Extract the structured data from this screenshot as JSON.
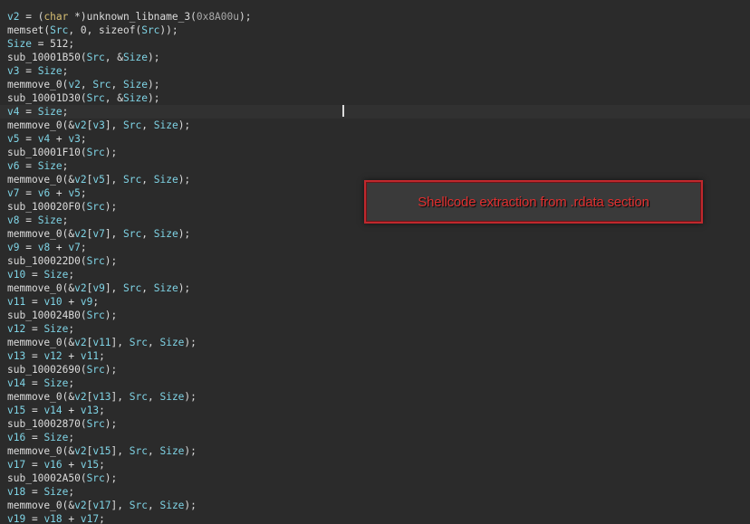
{
  "colors": {
    "background": "#2b2b2b",
    "identifier": "#7fd4e6",
    "keyword": "#d7bf73",
    "plain": "#dcdcdc",
    "number": "#a9a9a9",
    "annotation": "#e03030"
  },
  "code_lines": [
    [
      [
        "v2",
        "id"
      ],
      [
        " = (",
        "p"
      ],
      [
        "char",
        "kw"
      ],
      [
        " *)unknown_libname_3(",
        "p"
      ],
      [
        "0x8A00u",
        "num"
      ],
      [
        ");",
        "p"
      ]
    ],
    [
      [
        "memset(",
        "p"
      ],
      [
        "Src",
        "id"
      ],
      [
        ", 0, sizeof(",
        "p"
      ],
      [
        "Src",
        "id"
      ],
      [
        "));",
        "p"
      ]
    ],
    [
      [
        "Size",
        "id"
      ],
      [
        " = 512;",
        "p"
      ]
    ],
    [
      [
        "sub_10001B50(",
        "p"
      ],
      [
        "Src",
        "id"
      ],
      [
        ", &",
        "p"
      ],
      [
        "Size",
        "id"
      ],
      [
        ");",
        "p"
      ]
    ],
    [
      [
        "v3",
        "id"
      ],
      [
        " = ",
        "p"
      ],
      [
        "Size",
        "id"
      ],
      [
        ";",
        "p"
      ]
    ],
    [
      [
        "memmove_0(",
        "p"
      ],
      [
        "v2",
        "id"
      ],
      [
        ", ",
        "p"
      ],
      [
        "Src",
        "id"
      ],
      [
        ", ",
        "p"
      ],
      [
        "Size",
        "id"
      ],
      [
        ");",
        "p"
      ]
    ],
    [
      [
        "sub_10001D30(",
        "p"
      ],
      [
        "Src",
        "id"
      ],
      [
        ", &",
        "p"
      ],
      [
        "Size",
        "id"
      ],
      [
        ");",
        "p"
      ]
    ],
    [
      [
        "v4",
        "id"
      ],
      [
        " = ",
        "p"
      ],
      [
        "Size",
        "id"
      ],
      [
        ";",
        "p"
      ]
    ],
    [
      [
        "memmove_0(&",
        "p"
      ],
      [
        "v2",
        "id"
      ],
      [
        "[",
        "p"
      ],
      [
        "v3",
        "id"
      ],
      [
        "], ",
        "p"
      ],
      [
        "Src",
        "id"
      ],
      [
        ", ",
        "p"
      ],
      [
        "Size",
        "id"
      ],
      [
        ");",
        "p"
      ]
    ],
    [
      [
        "v5",
        "id"
      ],
      [
        " = ",
        "p"
      ],
      [
        "v4",
        "id"
      ],
      [
        " + ",
        "p"
      ],
      [
        "v3",
        "id"
      ],
      [
        ";",
        "p"
      ]
    ],
    [
      [
        "sub_10001F10(",
        "p"
      ],
      [
        "Src",
        "id"
      ],
      [
        ");",
        "p"
      ]
    ],
    [
      [
        "v6",
        "id"
      ],
      [
        " = ",
        "p"
      ],
      [
        "Size",
        "id"
      ],
      [
        ";",
        "p"
      ]
    ],
    [
      [
        "memmove_0(&",
        "p"
      ],
      [
        "v2",
        "id"
      ],
      [
        "[",
        "p"
      ],
      [
        "v5",
        "id"
      ],
      [
        "], ",
        "p"
      ],
      [
        "Src",
        "id"
      ],
      [
        ", ",
        "p"
      ],
      [
        "Size",
        "id"
      ],
      [
        ");",
        "p"
      ]
    ],
    [
      [
        "v7",
        "id"
      ],
      [
        " = ",
        "p"
      ],
      [
        "v6",
        "id"
      ],
      [
        " + ",
        "p"
      ],
      [
        "v5",
        "id"
      ],
      [
        ";",
        "p"
      ]
    ],
    [
      [
        "sub_100020F0(",
        "p"
      ],
      [
        "Src",
        "id"
      ],
      [
        ");",
        "p"
      ]
    ],
    [
      [
        "v8",
        "id"
      ],
      [
        " = ",
        "p"
      ],
      [
        "Size",
        "id"
      ],
      [
        ";",
        "p"
      ]
    ],
    [
      [
        "memmove_0(&",
        "p"
      ],
      [
        "v2",
        "id"
      ],
      [
        "[",
        "p"
      ],
      [
        "v7",
        "id"
      ],
      [
        "], ",
        "p"
      ],
      [
        "Src",
        "id"
      ],
      [
        ", ",
        "p"
      ],
      [
        "Size",
        "id"
      ],
      [
        ");",
        "p"
      ]
    ],
    [
      [
        "v9",
        "id"
      ],
      [
        " = ",
        "p"
      ],
      [
        "v8",
        "id"
      ],
      [
        " + ",
        "p"
      ],
      [
        "v7",
        "id"
      ],
      [
        ";",
        "p"
      ]
    ],
    [
      [
        "sub_100022D0(",
        "p"
      ],
      [
        "Src",
        "id"
      ],
      [
        ");",
        "p"
      ]
    ],
    [
      [
        "v10",
        "id"
      ],
      [
        " = ",
        "p"
      ],
      [
        "Size",
        "id"
      ],
      [
        ";",
        "p"
      ]
    ],
    [
      [
        "memmove_0(&",
        "p"
      ],
      [
        "v2",
        "id"
      ],
      [
        "[",
        "p"
      ],
      [
        "v9",
        "id"
      ],
      [
        "], ",
        "p"
      ],
      [
        "Src",
        "id"
      ],
      [
        ", ",
        "p"
      ],
      [
        "Size",
        "id"
      ],
      [
        ");",
        "p"
      ]
    ],
    [
      [
        "v11",
        "id"
      ],
      [
        " = ",
        "p"
      ],
      [
        "v10",
        "id"
      ],
      [
        " + ",
        "p"
      ],
      [
        "v9",
        "id"
      ],
      [
        ";",
        "p"
      ]
    ],
    [
      [
        "sub_100024B0(",
        "p"
      ],
      [
        "Src",
        "id"
      ],
      [
        ");",
        "p"
      ]
    ],
    [
      [
        "v12",
        "id"
      ],
      [
        " = ",
        "p"
      ],
      [
        "Size",
        "id"
      ],
      [
        ";",
        "p"
      ]
    ],
    [
      [
        "memmove_0(&",
        "p"
      ],
      [
        "v2",
        "id"
      ],
      [
        "[",
        "p"
      ],
      [
        "v11",
        "id"
      ],
      [
        "], ",
        "p"
      ],
      [
        "Src",
        "id"
      ],
      [
        ", ",
        "p"
      ],
      [
        "Size",
        "id"
      ],
      [
        ");",
        "p"
      ]
    ],
    [
      [
        "v13",
        "id"
      ],
      [
        " = ",
        "p"
      ],
      [
        "v12",
        "id"
      ],
      [
        " + ",
        "p"
      ],
      [
        "v11",
        "id"
      ],
      [
        ";",
        "p"
      ]
    ],
    [
      [
        "sub_10002690(",
        "p"
      ],
      [
        "Src",
        "id"
      ],
      [
        ");",
        "p"
      ]
    ],
    [
      [
        "v14",
        "id"
      ],
      [
        " = ",
        "p"
      ],
      [
        "Size",
        "id"
      ],
      [
        ";",
        "p"
      ]
    ],
    [
      [
        "memmove_0(&",
        "p"
      ],
      [
        "v2",
        "id"
      ],
      [
        "[",
        "p"
      ],
      [
        "v13",
        "id"
      ],
      [
        "], ",
        "p"
      ],
      [
        "Src",
        "id"
      ],
      [
        ", ",
        "p"
      ],
      [
        "Size",
        "id"
      ],
      [
        ");",
        "p"
      ]
    ],
    [
      [
        "v15",
        "id"
      ],
      [
        " = ",
        "p"
      ],
      [
        "v14",
        "id"
      ],
      [
        " + ",
        "p"
      ],
      [
        "v13",
        "id"
      ],
      [
        ";",
        "p"
      ]
    ],
    [
      [
        "sub_10002870(",
        "p"
      ],
      [
        "Src",
        "id"
      ],
      [
        ");",
        "p"
      ]
    ],
    [
      [
        "v16",
        "id"
      ],
      [
        " = ",
        "p"
      ],
      [
        "Size",
        "id"
      ],
      [
        ";",
        "p"
      ]
    ],
    [
      [
        "memmove_0(&",
        "p"
      ],
      [
        "v2",
        "id"
      ],
      [
        "[",
        "p"
      ],
      [
        "v15",
        "id"
      ],
      [
        "], ",
        "p"
      ],
      [
        "Src",
        "id"
      ],
      [
        ", ",
        "p"
      ],
      [
        "Size",
        "id"
      ],
      [
        ");",
        "p"
      ]
    ],
    [
      [
        "v17",
        "id"
      ],
      [
        " = ",
        "p"
      ],
      [
        "v16",
        "id"
      ],
      [
        " + ",
        "p"
      ],
      [
        "v15",
        "id"
      ],
      [
        ";",
        "p"
      ]
    ],
    [
      [
        "sub_10002A50(",
        "p"
      ],
      [
        "Src",
        "id"
      ],
      [
        ");",
        "p"
      ]
    ],
    [
      [
        "v18",
        "id"
      ],
      [
        " = ",
        "p"
      ],
      [
        "Size",
        "id"
      ],
      [
        ";",
        "p"
      ]
    ],
    [
      [
        "memmove_0(&",
        "p"
      ],
      [
        "v2",
        "id"
      ],
      [
        "[",
        "p"
      ],
      [
        "v17",
        "id"
      ],
      [
        "], ",
        "p"
      ],
      [
        "Src",
        "id"
      ],
      [
        ", ",
        "p"
      ],
      [
        "Size",
        "id"
      ],
      [
        ");",
        "p"
      ]
    ],
    [
      [
        "v19",
        "id"
      ],
      [
        " = ",
        "p"
      ],
      [
        "v18",
        "id"
      ],
      [
        " + ",
        "p"
      ],
      [
        "v17",
        "id"
      ],
      [
        ";",
        "p"
      ]
    ]
  ],
  "annotation": {
    "text": "Shellcode extraction from .rdata section"
  }
}
